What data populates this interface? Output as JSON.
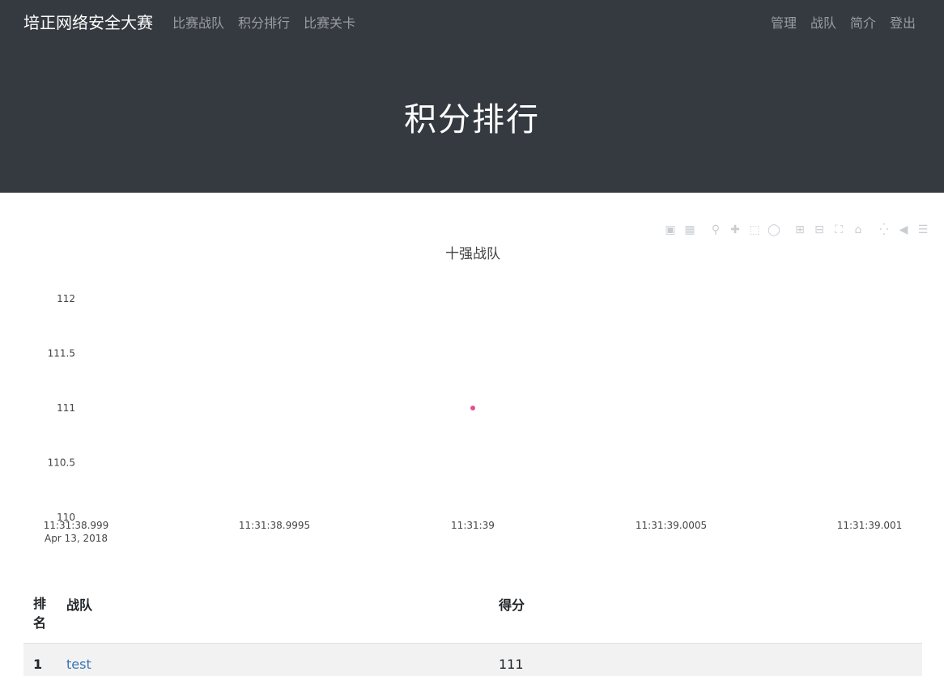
{
  "navbar": {
    "brand": "培正网络安全大赛",
    "left_links": [
      "比赛战队",
      "积分排行",
      "比赛关卡"
    ],
    "right_links": [
      "管理",
      "战队",
      "简介",
      "登出"
    ]
  },
  "jumbotron": {
    "title": "积分排行"
  },
  "modebar": {
    "buttons": [
      "camera-icon",
      "save-icon",
      "zoom-icon",
      "pan-icon",
      "box-select-icon",
      "lasso-icon",
      "zoom-in-icon",
      "zoom-out-icon",
      "autoscale-icon",
      "reset-axes-icon",
      "spike-lines-icon",
      "hover-closest-icon",
      "hover-compare-icon"
    ]
  },
  "chart_data": {
    "type": "scatter",
    "title": "十强战队",
    "x_ticks": [
      "11:31:38.999",
      "11:31:38.9995",
      "11:31:39",
      "11:31:39.0005",
      "11:31:39.001"
    ],
    "x_date_label": "Apr 13, 2018",
    "y_ticks": [
      "112",
      "111.5",
      "111",
      "110.5",
      "110"
    ],
    "ylim": [
      110,
      112
    ],
    "series": [
      {
        "x": [
          "2018-04-13 11:31:39"
        ],
        "y": [
          111
        ],
        "color": "#e0508f"
      }
    ],
    "grid": false
  },
  "table": {
    "headers": {
      "rank": "排名",
      "team": "战队",
      "score": "得分"
    },
    "rows": [
      {
        "rank": "1",
        "team": "test",
        "score": "111"
      }
    ]
  }
}
